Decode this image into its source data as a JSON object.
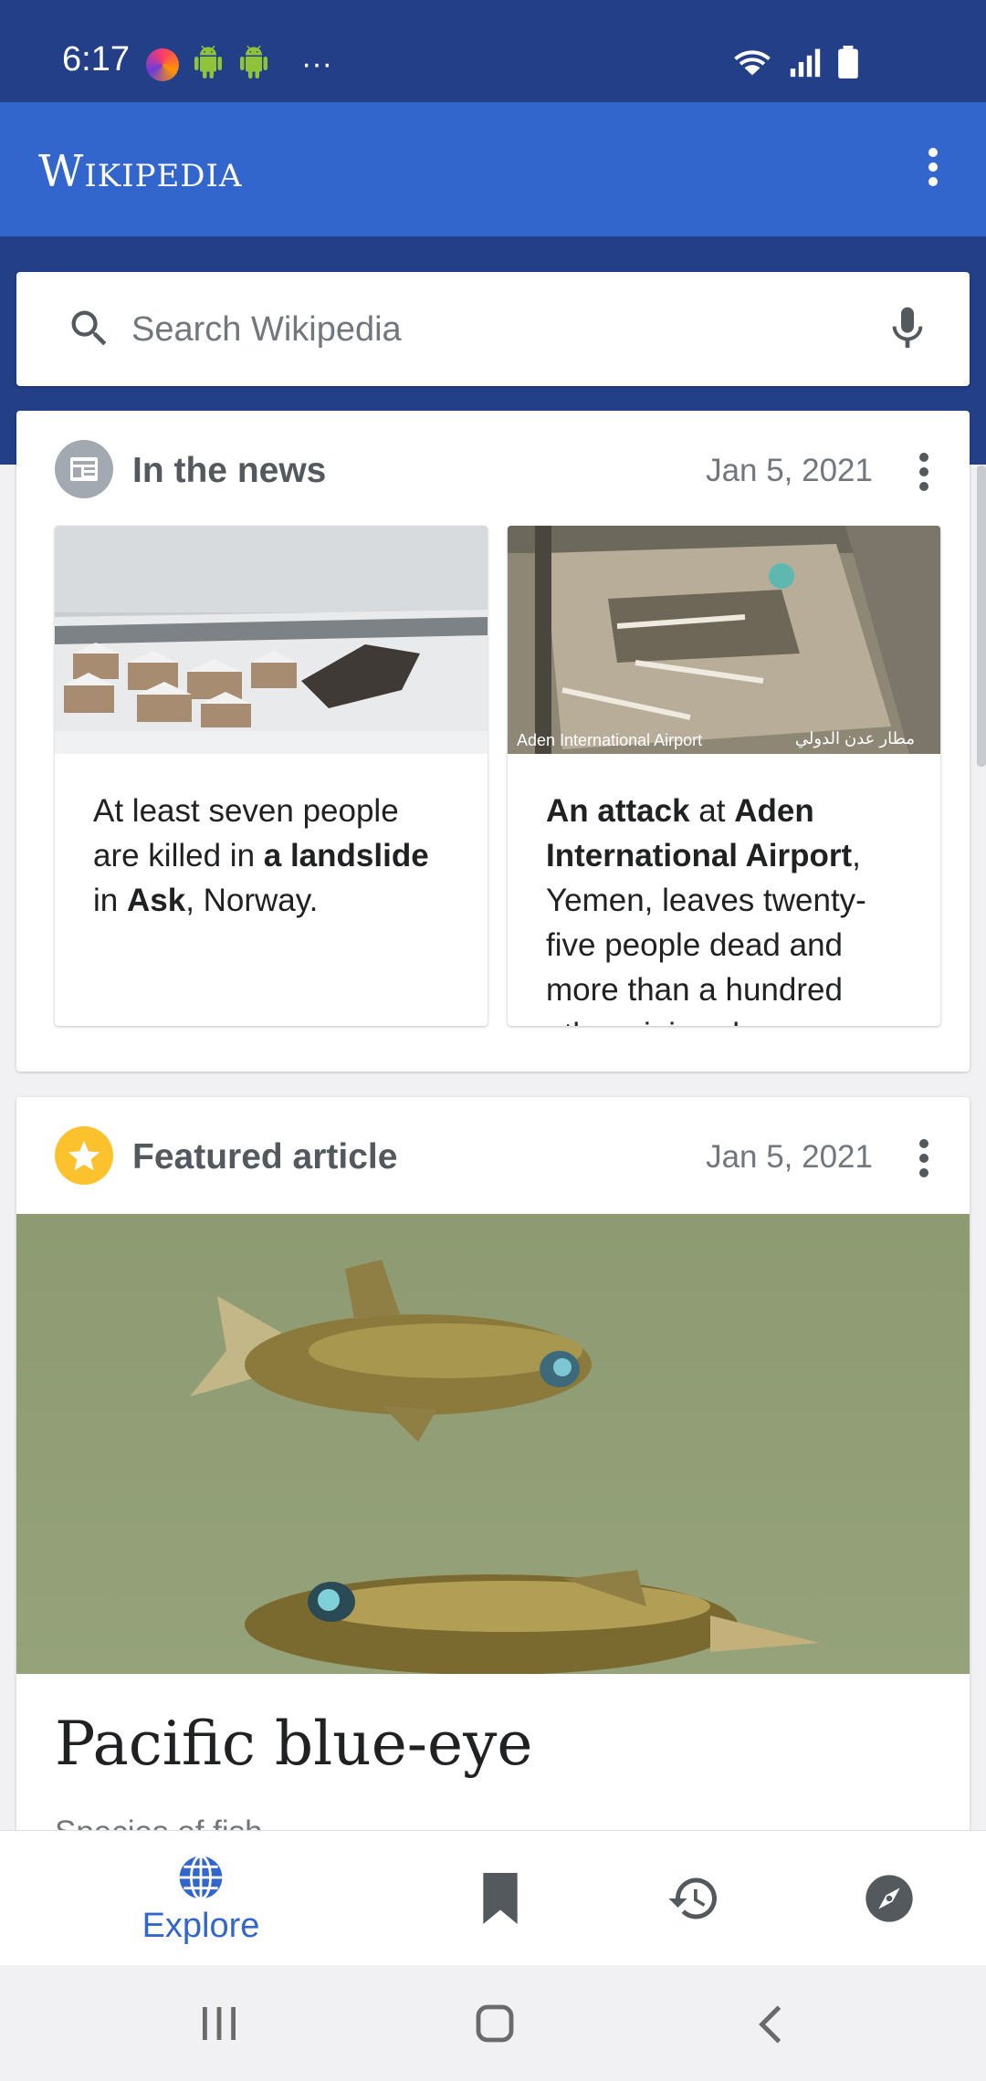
{
  "status_bar": {
    "time": "6:17"
  },
  "app_bar": {
    "logo": "Wikipedia"
  },
  "search": {
    "placeholder": "Search Wikipedia"
  },
  "news_card": {
    "title": "In the news",
    "date": "Jan 5, 2021",
    "items": [
      {
        "image_caption": "",
        "text_parts": [
          "At least seven people are killed in ",
          "a landslide",
          " in ",
          "Ask",
          ", Norway."
        ]
      },
      {
        "image_caption": "Aden International Airport",
        "image_caption_right": "مطار عدن الدولي",
        "text_parts": [
          "An attack",
          " at ",
          "Aden International Airport",
          ", Yemen, leaves twenty-five people dead and more than a hundred others injured."
        ]
      }
    ]
  },
  "featured_card": {
    "title": "Featured article",
    "date": "Jan 5, 2021",
    "article_title": "Pacific blue-eye",
    "article_desc": "Species of fish"
  },
  "bottom_nav": {
    "explore_label": "Explore",
    "items": [
      "explore",
      "saved",
      "history",
      "nearby"
    ]
  },
  "colors": {
    "brand_blue": "#3366cc",
    "dark_blue": "#233f88",
    "star_yellow": "#fcc22d"
  }
}
